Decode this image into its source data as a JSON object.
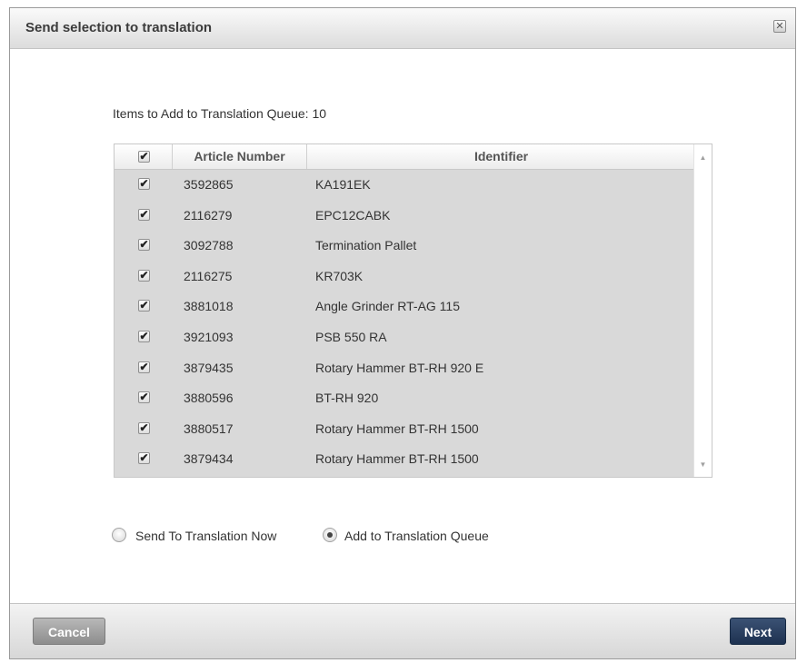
{
  "dialog": {
    "title": "Send selection to translation",
    "close_glyph": "✕"
  },
  "items_label": "Items to Add to Translation Queue: 10",
  "grid": {
    "header_checkbox_checked": true,
    "columns": [
      "Article Number",
      "Identifier"
    ],
    "rows": [
      {
        "checked": true,
        "article": "3592865",
        "identifier": "KA191EK"
      },
      {
        "checked": true,
        "article": "2116279",
        "identifier": "EPC12CABK"
      },
      {
        "checked": true,
        "article": "3092788",
        "identifier": "Termination Pallet"
      },
      {
        "checked": true,
        "article": "2116275",
        "identifier": "KR703K"
      },
      {
        "checked": true,
        "article": "3881018",
        "identifier": "Angle Grinder RT-AG 115"
      },
      {
        "checked": true,
        "article": "3921093",
        "identifier": "PSB 550 RA"
      },
      {
        "checked": true,
        "article": "3879435",
        "identifier": "Rotary Hammer BT-RH 920 E"
      },
      {
        "checked": true,
        "article": "3880596",
        "identifier": "BT-RH 920"
      },
      {
        "checked": true,
        "article": "3880517",
        "identifier": "Rotary Hammer BT-RH 1500"
      },
      {
        "checked": true,
        "article": "3879434",
        "identifier": "Rotary Hammer BT-RH 1500"
      }
    ],
    "scroll_up_glyph": "▲",
    "scroll_down_glyph": "▼"
  },
  "options": {
    "send_now_label": "Send To Translation Now",
    "add_queue_label": "Add to Translation Queue",
    "selected": "add_queue"
  },
  "footer": {
    "cancel_label": "Cancel",
    "next_label": "Next"
  },
  "icons": {
    "close": "close-icon",
    "checkbox_mark": "✔",
    "scroll_up": "scroll-up-icon",
    "scroll_down": "scroll-down-icon"
  },
  "colors": {
    "next_button": "#1d3150",
    "cancel_button": "#8d8d8d",
    "grid_background": "#d9d9d9"
  }
}
